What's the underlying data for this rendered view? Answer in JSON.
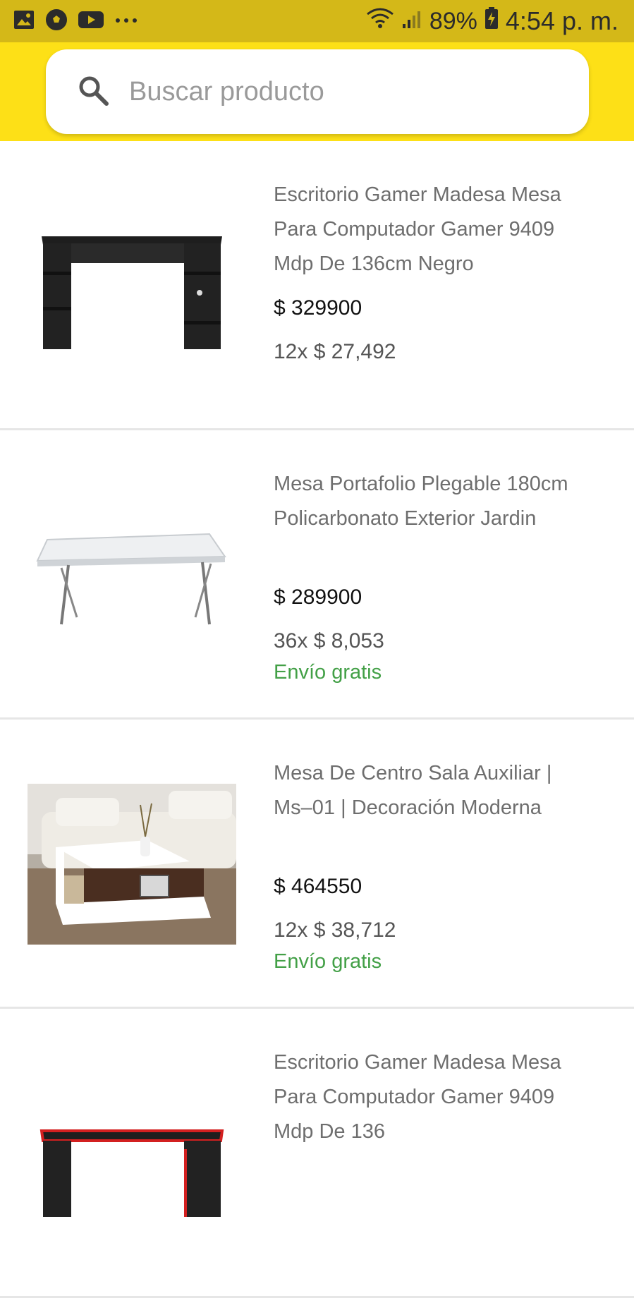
{
  "status_bar": {
    "battery": "89%",
    "time": "4:54 p. m.",
    "left_icons": [
      "gallery-icon",
      "soccer-ball-icon",
      "youtube-icon",
      "more-dots-icon"
    ],
    "right_icons": [
      "wifi-icon",
      "signal-icon",
      "battery-charging-icon"
    ]
  },
  "search": {
    "placeholder": "Buscar producto",
    "icon": "search-icon"
  },
  "colors": {
    "status_bar": "#d4b818",
    "header": "#fde017",
    "free_shipping": "#43a047"
  },
  "products": [
    {
      "title": "Escritorio Gamer Madesa Mesa Para Computador Gamer 9409 Mdp De 136cm Negro",
      "price": "$ 329900",
      "installments": "12x $ 27,492",
      "shipping": "",
      "image": "black-desk-image"
    },
    {
      "title": "Mesa Portafolio Plegable 180cm Policarbonato Exterior Jardin",
      "price": "$ 289900",
      "installments": "36x $ 8,053",
      "shipping": "Envío gratis",
      "image": "folding-table-image"
    },
    {
      "title": "Mesa De Centro Sala Auxiliar | Ms–01 | Decoración Moderna",
      "price": "$ 464550",
      "installments": "12x $ 38,712",
      "shipping": "Envío gratis",
      "image": "coffee-table-image"
    },
    {
      "title": "Escritorio Gamer Madesa Mesa Para Computador Gamer 9409 Mdp De 136",
      "price": "",
      "installments": "",
      "shipping": "",
      "image": "red-black-desk-image"
    }
  ]
}
